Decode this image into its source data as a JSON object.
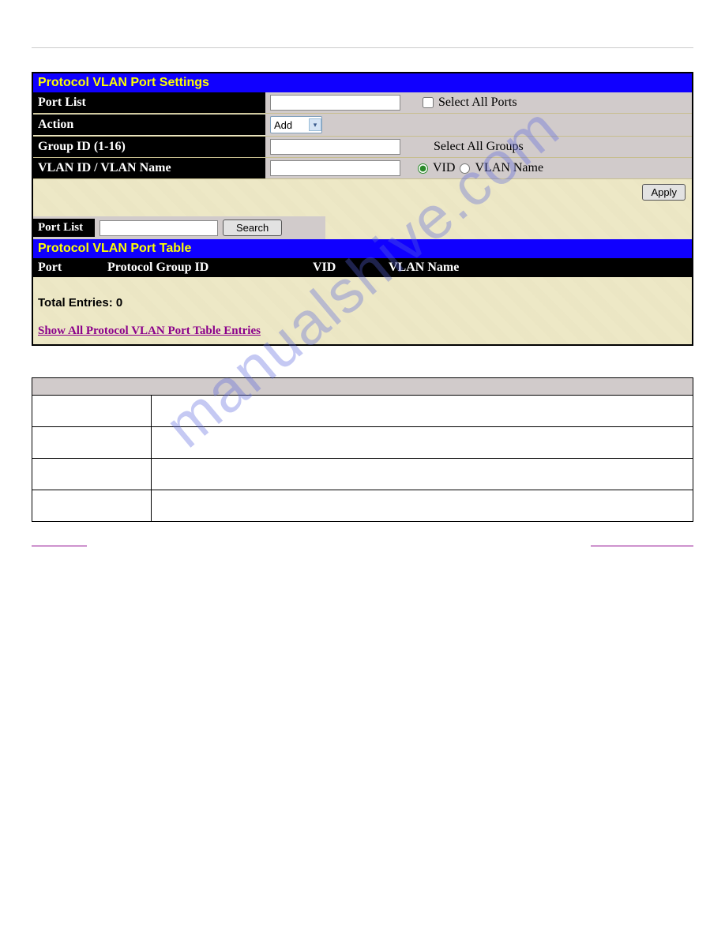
{
  "watermark": "manualshive.com",
  "panel": {
    "settings_header": "Protocol VLAN Port Settings",
    "rows": {
      "port_list_label": "Port List",
      "select_all_ports_label": "Select All Ports",
      "action_label": "Action",
      "action_value": "Add",
      "group_id_label": "Group ID (1-16)",
      "select_all_groups_label": "Select All Groups",
      "vlan_id_name_label": "VLAN ID / VLAN Name",
      "vid_label": "VID",
      "vlan_name_label": "VLAN Name"
    },
    "apply_label": "Apply",
    "search_section": {
      "port_list_label": "Port List",
      "search_button": "Search"
    },
    "table_header": "Protocol VLAN Port Table",
    "columns": {
      "port": "Port",
      "protocol_group_id": "Protocol Group ID",
      "vid": "VID",
      "vlan_name": "VLAN Name"
    },
    "total_entries_label": "Total Entries:",
    "total_entries_value": "0",
    "show_all_link": "Show All Protocol VLAN Port Table Entries"
  }
}
